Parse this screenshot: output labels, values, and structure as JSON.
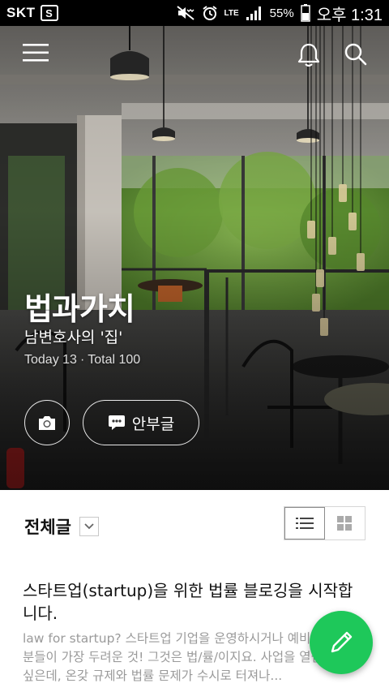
{
  "status_bar": {
    "carrier": "SKT",
    "carrier_badge": "S",
    "network": "LTE",
    "battery_percent": "55%",
    "time": "오후 1:31"
  },
  "header": {
    "icons": [
      "menu-icon",
      "bell-icon",
      "search-icon"
    ]
  },
  "blog": {
    "title": "법과가치",
    "subtitle": "남변호사의 '집'",
    "today_label": "Today 13",
    "separator": "·",
    "total_label": "Total 100",
    "notice_button_label": "안부글"
  },
  "posts_section": {
    "title": "전체글",
    "view_modes": [
      "list-view",
      "grid-view"
    ],
    "active_view": "list-view"
  },
  "post": {
    "title": "스타트업(startup)을 위한 법률 블로깅을 시작합니다.",
    "excerpt": "law for startup? 스타트업 기업을 운영하시거나 예비 창업자 분들이 가장 두려운 것! 그것은 법/률/이지요. 사업을 열심히 하고 싶은데, 온갖 규제와 법률 문제가 수시로 터져나..."
  },
  "colors": {
    "fab": "#1ec85a",
    "status_bar": "#000000"
  }
}
